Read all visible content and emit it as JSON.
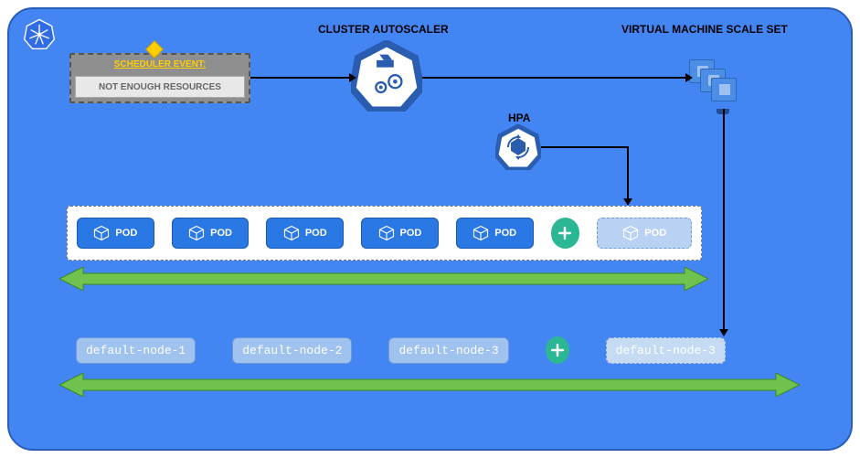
{
  "labels": {
    "cluster_autoscaler": "CLUSTER AUTOSCALER",
    "vmss": "VIRTUAL MACHINE SCALE SET",
    "hpa": "HPA",
    "scheduler_title": "SCHEDULER EVENT:",
    "scheduler_sub": "NOT ENOUGH RESOURCES"
  },
  "pods": {
    "label": "POD",
    "count_existing": 5,
    "count_new": 1
  },
  "nodes": {
    "items": [
      "default-node-1",
      "default-node-2",
      "default-node-3"
    ],
    "new_item": "default-node-3"
  },
  "colors": {
    "bg": "#4485f4",
    "accent": "#2a78e4",
    "green": "#2bb794",
    "arrow_green": "#5fb84e"
  }
}
